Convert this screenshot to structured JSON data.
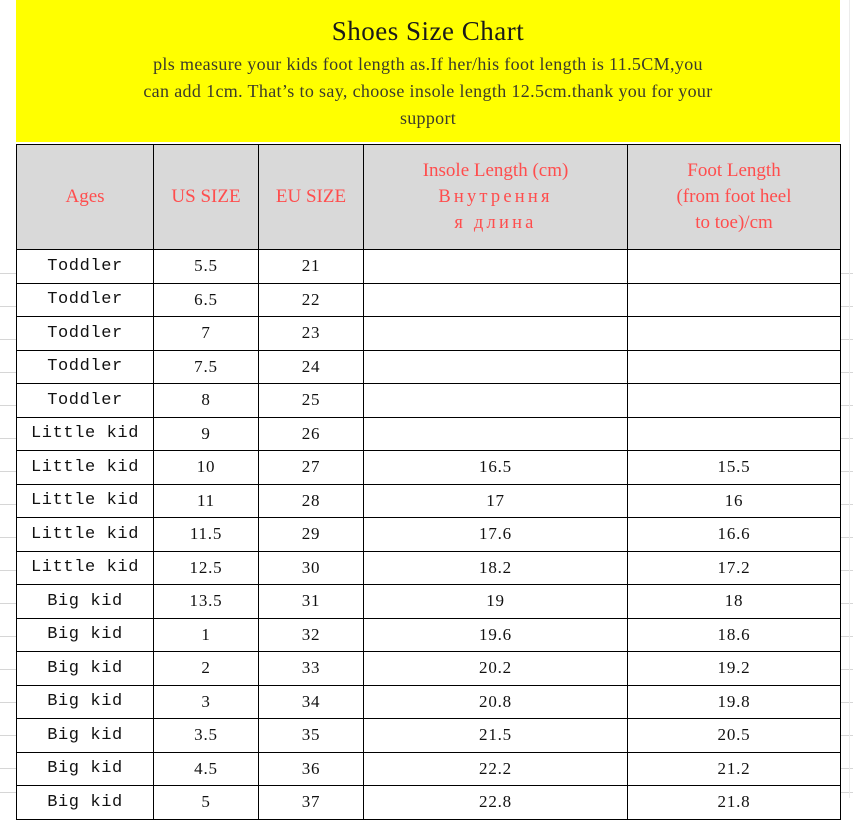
{
  "banner": {
    "title": "Shoes Size Chart",
    "lines": [
      "pls measure your kids foot length as.If her/his foot length is 11.5CM,you",
      "can add 1cm. That’s to say, choose insole length 12.5cm.thank you for your",
      "support"
    ],
    "background_color": "#ffff00",
    "title_color": "#1a1a1a"
  },
  "table": {
    "header_background": "#d9d9d9",
    "header_text_color": "#ff4d4d",
    "columns": [
      {
        "key": "ages",
        "label": "Ages"
      },
      {
        "key": "us_size",
        "label": "US SIZE"
      },
      {
        "key": "eu_size",
        "label": "EU SIZE"
      },
      {
        "key": "insole",
        "label_line1": "Insole Length (cm)",
        "label_line2": "Внутрення",
        "label_line3": "я длина"
      },
      {
        "key": "foot",
        "label_line1": "Foot Length",
        "label_line2": "(from foot heel",
        "label_line3": "to toe)/cm"
      }
    ],
    "rows": [
      {
        "ages": "Toddler",
        "us_size": "5.5",
        "eu_size": "21",
        "insole": "",
        "foot": ""
      },
      {
        "ages": "Toddler",
        "us_size": "6.5",
        "eu_size": "22",
        "insole": "",
        "foot": ""
      },
      {
        "ages": "Toddler",
        "us_size": "7",
        "eu_size": "23",
        "insole": "",
        "foot": ""
      },
      {
        "ages": "Toddler",
        "us_size": "7.5",
        "eu_size": "24",
        "insole": "",
        "foot": ""
      },
      {
        "ages": "Toddler",
        "us_size": "8",
        "eu_size": "25",
        "insole": "",
        "foot": ""
      },
      {
        "ages": "Little kid",
        "us_size": "9",
        "eu_size": "26",
        "insole": "",
        "foot": ""
      },
      {
        "ages": "Little kid",
        "us_size": "10",
        "eu_size": "27",
        "insole": "16.5",
        "foot": "15.5"
      },
      {
        "ages": "Little kid",
        "us_size": "11",
        "eu_size": "28",
        "insole": "17",
        "foot": "16"
      },
      {
        "ages": "Little kid",
        "us_size": "11.5",
        "eu_size": "29",
        "insole": "17.6",
        "foot": "16.6"
      },
      {
        "ages": "Little kid",
        "us_size": "12.5",
        "eu_size": "30",
        "insole": "18.2",
        "foot": "17.2"
      },
      {
        "ages": "Big kid",
        "us_size": "13.5",
        "eu_size": "31",
        "insole": "19",
        "foot": "18"
      },
      {
        "ages": "Big kid",
        "us_size": "1",
        "eu_size": "32",
        "insole": "19.6",
        "foot": "18.6"
      },
      {
        "ages": "Big kid",
        "us_size": "2",
        "eu_size": "33",
        "insole": "20.2",
        "foot": "19.2"
      },
      {
        "ages": "Big kid",
        "us_size": "3",
        "eu_size": "34",
        "insole": "20.8",
        "foot": "19.8"
      },
      {
        "ages": "Big kid",
        "us_size": "3.5",
        "eu_size": "35",
        "insole": "21.5",
        "foot": "20.5"
      },
      {
        "ages": "Big kid",
        "us_size": "4.5",
        "eu_size": "36",
        "insole": "22.2",
        "foot": "21.2"
      },
      {
        "ages": "Big kid",
        "us_size": "5",
        "eu_size": "37",
        "insole": "22.8",
        "foot": "21.8"
      }
    ]
  }
}
